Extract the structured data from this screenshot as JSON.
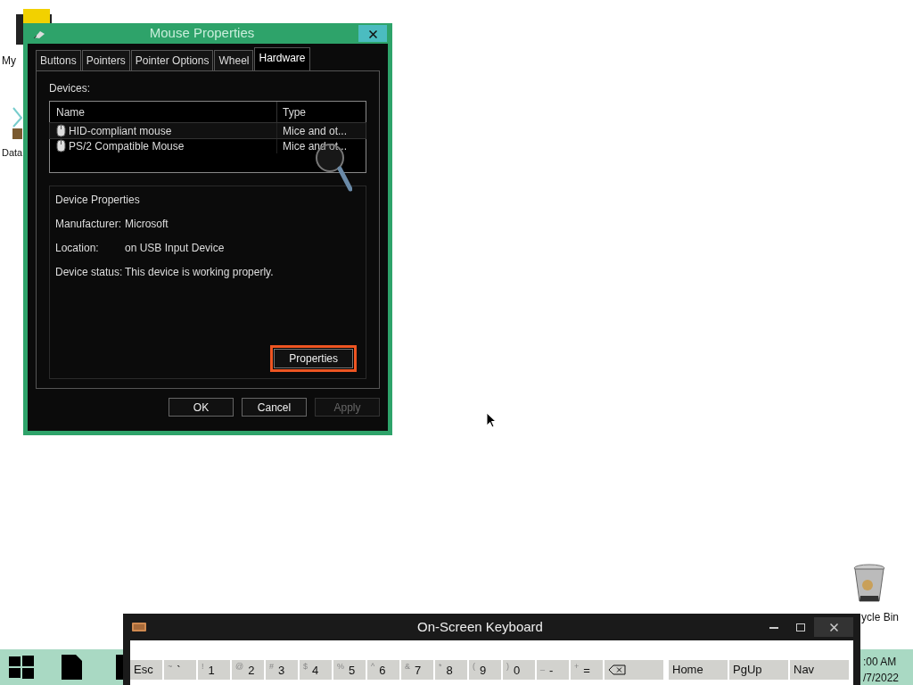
{
  "desktop_icons": [
    {
      "kind": "computer",
      "label": "My"
    },
    {
      "kind": "database",
      "label": "Data"
    },
    {
      "kind": "recycle",
      "label": "ycle Bin"
    }
  ],
  "dialog": {
    "title": "Mouse Properties",
    "tabs": [
      {
        "label": "Buttons",
        "selected": false
      },
      {
        "label": "Pointers",
        "selected": false
      },
      {
        "label": "Pointer Options",
        "selected": false
      },
      {
        "label": "Wheel",
        "selected": false
      },
      {
        "label": "Hardware",
        "selected": true
      }
    ],
    "devices_label": "Devices:",
    "columns": [
      "Name",
      "Type"
    ],
    "rows": [
      {
        "name": "HID-compliant mouse",
        "type": "Mice and ot...",
        "selected": true
      },
      {
        "name": "PS/2 Compatible Mouse",
        "type": "Mice and ot...",
        "selected": false
      }
    ],
    "group_title": "Device Properties",
    "properties": [
      {
        "label": "Manufacturer:",
        "value": "Microsoft"
      },
      {
        "label": "Location:",
        "value": "on USB Input Device"
      },
      {
        "label": "Device status:",
        "value": "This device is working properly."
      }
    ],
    "properties_button": {
      "label": "Properties",
      "highlighted": true
    },
    "buttons": [
      {
        "label": "OK",
        "disabled": false
      },
      {
        "label": "Cancel",
        "disabled": false
      },
      {
        "label": "Apply",
        "disabled": true
      }
    ]
  },
  "keyboard": {
    "title": "On-Screen Keyboard",
    "keys": [
      {
        "kind": "text",
        "main": "Esc"
      },
      {
        "kind": "pair",
        "shift": "~",
        "main": "`"
      },
      {
        "kind": "pair",
        "shift": "!",
        "main": "1"
      },
      {
        "kind": "pair",
        "shift": "@",
        "main": "2"
      },
      {
        "kind": "pair",
        "shift": "#",
        "main": "3"
      },
      {
        "kind": "pair",
        "shift": "$",
        "main": "4"
      },
      {
        "kind": "pair",
        "shift": "%",
        "main": "5"
      },
      {
        "kind": "pair",
        "shift": "^",
        "main": "6"
      },
      {
        "kind": "pair",
        "shift": "&",
        "main": "7"
      },
      {
        "kind": "pair",
        "shift": "*",
        "main": "8"
      },
      {
        "kind": "pair",
        "shift": "(",
        "main": "9"
      },
      {
        "kind": "pair",
        "shift": ")",
        "main": "0"
      },
      {
        "kind": "pair",
        "shift": "_",
        "main": "-"
      },
      {
        "kind": "pair",
        "shift": "+",
        "main": "="
      },
      {
        "kind": "backspace"
      }
    ],
    "nav_keys": [
      "Home",
      "PgUp",
      "Nav"
    ]
  },
  "taskbar": {
    "time": ":00 AM",
    "date": "/7/2022"
  }
}
